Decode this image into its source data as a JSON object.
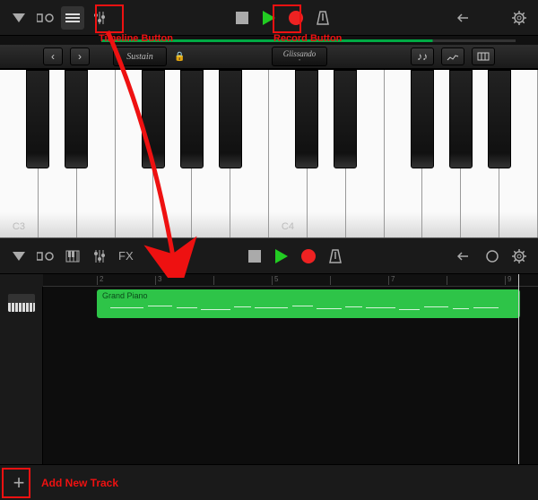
{
  "top": {
    "annotations": {
      "timeline": "Timeline Button",
      "record": "Record Button"
    },
    "options": {
      "sustain": "Sustain",
      "glissando": "Glissando"
    },
    "keys": {
      "c3": "C3",
      "c4": "C4"
    }
  },
  "bottom": {
    "fx": "FX",
    "track": {
      "name": "Grand Piano"
    },
    "annotations": {
      "add_track": "Add New Track"
    }
  }
}
